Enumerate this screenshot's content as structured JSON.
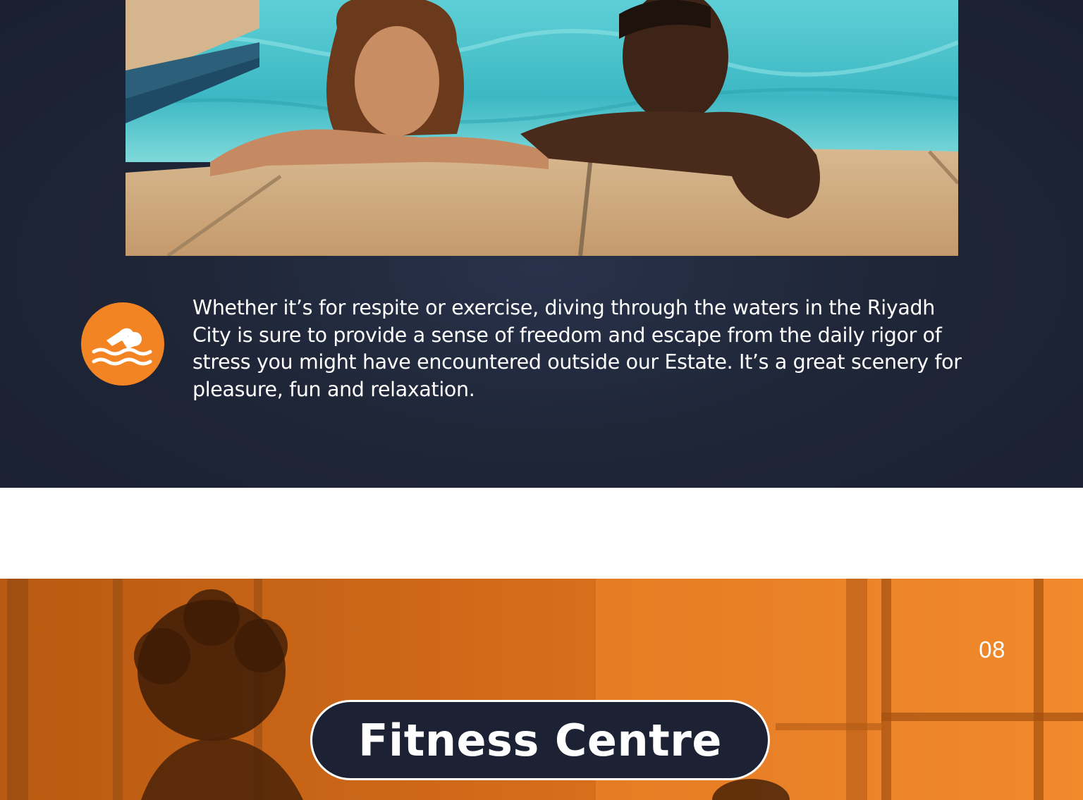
{
  "pool": {
    "photo_alt": "",
    "icon": "swimming-icon",
    "description": "Whether it’s for respite or exercise, diving through the waters in the Riyadh City is sure to provide a sense of freedom and escape from the daily rigor of stress you might have encountered outside our Estate. It’s a great scenery for pleasure, fun and relaxation."
  },
  "fitness": {
    "page_number": "08",
    "title": "Fitness Centre"
  },
  "colors": {
    "navy": "#1c2234",
    "orange": "#f28423",
    "white": "#ffffff"
  }
}
